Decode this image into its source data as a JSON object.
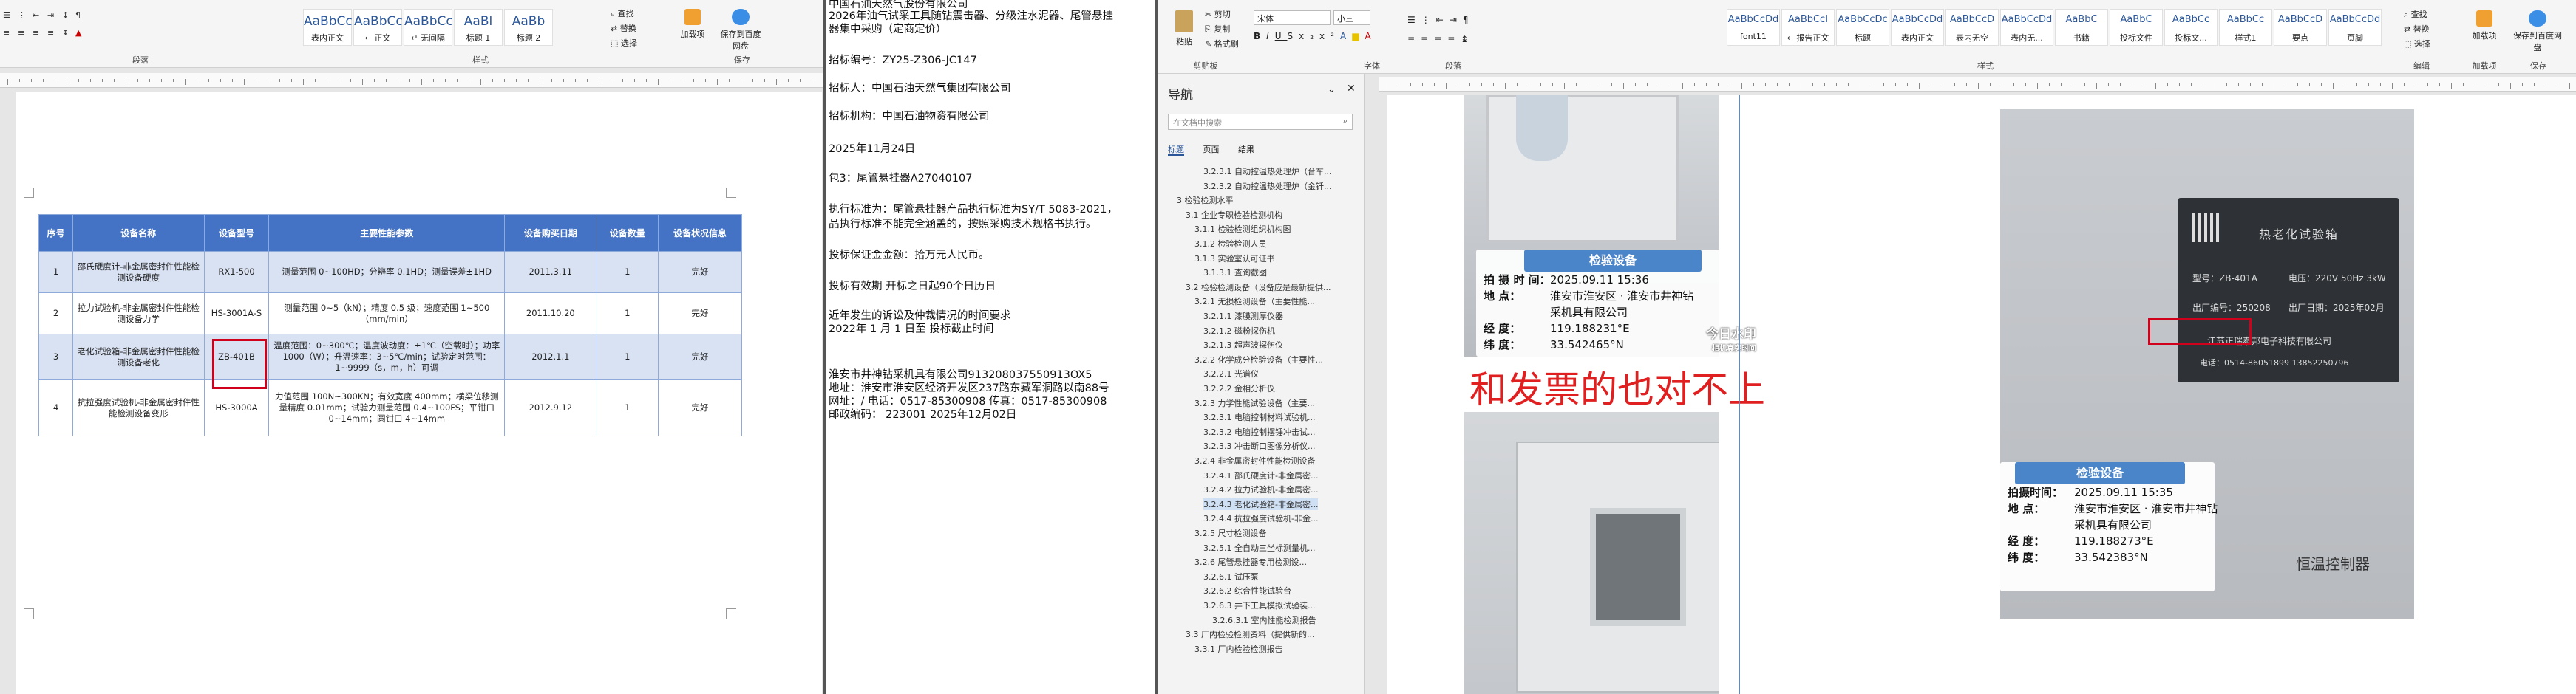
{
  "pane1": {
    "ribbon": {
      "groups": [
        "段落",
        "样式"
      ],
      "styles": [
        {
          "sample": "AaBbCcDd",
          "name": "表内正文"
        },
        {
          "sample": "AaBbCcDd",
          "name": "↵ 正文"
        },
        {
          "sample": "AaBbCcDd",
          "name": "↵ 无间隔"
        },
        {
          "sample": "AaBl",
          "name": "标题 1"
        },
        {
          "sample": "AaBb",
          "name": "标题 2"
        }
      ],
      "edit_items": [
        "查找",
        "替换",
        "选择"
      ],
      "addon_label": "加载项",
      "save_label": "保存到百度网盘",
      "save_group": "保存"
    },
    "table": {
      "headers": [
        "序号",
        "设备名称",
        "设备型号",
        "主要性能参数",
        "设备购买日期",
        "设备数量",
        "设备状况信息"
      ],
      "rows": [
        [
          "1",
          "邵氏硬度计-非金属密封件性能检测设备硬度",
          "RX1-500",
          "测量范围 0~100HD；分辨率 0.1HD；测量误差±1HD",
          "2011.3.11",
          "1",
          "完好"
        ],
        [
          "2",
          "拉力试验机-非金属密封件性能检测设备力学",
          "HS-3001A-S",
          "测量范围 0~5（kN）；精度 0.5 级；速度范围 1~500（mm/min）",
          "2011.10.20",
          "1",
          "完好"
        ],
        [
          "3",
          "老化试验箱-非金属密封件性能检测设备老化",
          "ZB-401B",
          "温度范围：0~300℃；温度波动度：±1℃（空载时）；功率 1000（W）；升温速率：3~5℃/min；试验定时范围： 1~9999（s，m，h）可调",
          "2012.1.1",
          "1",
          "完好"
        ],
        [
          "4",
          "抗拉强度试验机-非金属密封件性能检测设备变形",
          "HS-3000A",
          "力值范围 100N~300KN；有效宽度 400mm；横梁位移测量精度 0.01mm；试验力测量范围 0.4~100FS；平钳口 0~14mm；圆钳口 4~14mm",
          "2012.9.12",
          "1",
          "完好"
        ]
      ]
    }
  },
  "pane2": {
    "lines": [
      "中国石油天然气股份有限公司",
      "2026年油气试采工具随钻震击器、分级注水泥器、尾管悬挂",
      "器集中采购（定商定价）",
      "招标编号：ZY25-Z306-JC147",
      "招标人：中国石油天然气集团有限公司",
      "招标机构：中国石油物资有限公司",
      "2025年11月24日",
      "包3：尾管悬挂器A27040107",
      "执行标准为：尾管悬挂器产品执行标准为SY/T 5083-2021，",
      "品执行标准不能完全涵盖的，按照采购技术规格书执行。",
      "投标保证金金额：拾万元人民币。",
      "投标有效期  开标之日起90个日历日",
      "近年发生的诉讼及仲裁情况的时间要求",
      "2022年 1 月 1 日至 投标截止时间",
      "淮安市井神钻采机具有限公司913208037550913OX5",
      "地址：淮安市淮安区经济开发区237路东藏军洞路以南88号",
      "网址：/  电话：0517-85300908    传真：0517-85300908",
      "邮政编码：    223001                   2025年12月02日"
    ]
  },
  "pane3": {
    "ribbon": {
      "font_name": "宋体",
      "font_size": "小三",
      "groups": [
        "剪贴板",
        "字体",
        "段落",
        "样式",
        "编辑",
        "加载项",
        "保存"
      ],
      "clipboard": [
        "剪切",
        "复制",
        "格式刷"
      ],
      "paste_label": "粘贴",
      "styles": [
        {
          "sample": "AaBbCcDd",
          "name": "font11"
        },
        {
          "sample": "AaBbCcI",
          "name": "↵ 报告正文"
        },
        {
          "sample": "AaBbCcDc",
          "name": "标题"
        },
        {
          "sample": "AaBbCcDd",
          "name": "表内正文"
        },
        {
          "sample": "AaBbCcD",
          "name": "表内无空"
        },
        {
          "sample": "AaBbCcDd",
          "name": "表内无..."
        },
        {
          "sample": "AaBbC",
          "name": "书籍"
        },
        {
          "sample": "AaBbC",
          "name": "投标文件"
        },
        {
          "sample": "AaBbCc",
          "name": "投标文..."
        },
        {
          "sample": "AaBbCc",
          "name": "样式1"
        },
        {
          "sample": "AaBbCcD",
          "name": "要点"
        },
        {
          "sample": "AaBbCcDd",
          "name": "页脚"
        }
      ],
      "edit_items": [
        "查找",
        "替换",
        "选择"
      ],
      "addon_label": "加载项",
      "save_label": "保存到百度网盘"
    },
    "nav": {
      "title": "导航",
      "search_placeholder": "在文档中搜索",
      "tabs": [
        "标题",
        "页面",
        "结果"
      ],
      "items": [
        "3.2.3.1 自动控温热处理炉（台车...",
        "3.2.3.2 自动控温热处理炉（金钎...",
        "3 检验检测水平",
        "3.1 企业专职检验检测机构",
        "3.1.1 检验检测组织机构图",
        "3.1.2 检验检测人员",
        "3.1.3 实验室认可证书",
        "3.1.3.1 查询截图",
        "3.2 检验检测设备（设备应是最新提供...",
        "3.2.1 无损检测设备（主要性能...",
        "3.2.1.1 漆膜测厚仪器",
        "3.2.1.2 磁粉探伤机",
        "3.2.1.3 超声波探伤仪",
        "3.2.2 化学成分检验设备（主要性...",
        "3.2.2.1 光谱仪",
        "3.2.2.2 金相分析仪",
        "3.2.3 力学性能试验设备（主要...",
        "3.2.3.1 电脑控制材料试验机...",
        "3.2.3.2 电脑控制摆锤冲击试...",
        "3.2.3.3 冲击断口图像分析仪...",
        "3.2.4 非金属密封件性能检测设备",
        "3.2.4.1 邵氏硬度计-非金属密...",
        "3.2.4.2 拉力试验机-非金属密...",
        "3.2.4.3 老化试验箱-非金属密...",
        "3.2.4.4 抗拉强度试验机-非金...",
        "3.2.5 尺寸检测设备",
        "3.2.5.1 全自动三坐标测量机...",
        "3.2.6 尾管悬挂器专用检测设...",
        "3.2.6.1 试压泵",
        "3.2.6.2 综合性能试验台",
        "3.2.6.3 井下工具模拟试验装...",
        "3.2.6.3.1 室内性能检测报告",
        "3.3 厂内检验检测资料（提供新的...",
        "3.3.1 厂内检验检测报告"
      ]
    },
    "photo1_stamp": {
      "title": "检验设备",
      "rows": [
        {
          "k": "拍 摄 时 间：",
          "v": "2025.09.11 15:36"
        },
        {
          "k": "地      点：",
          "v": "淮安市淮安区 · 淮安市井神钻"
        },
        {
          "k": "",
          "v": "采机具有限公司"
        },
        {
          "k": "经      度：",
          "v": "119.188231°E"
        },
        {
          "k": "纬      度：",
          "v": "33.542465°N"
        }
      ],
      "watermark": "今日水印",
      "watermark_sub": "相机真实时间"
    },
    "annotation_text": "和发票的也对不上",
    "photo3": {
      "plate_title": "热老化试验箱",
      "plate_model": "型号：ZB-401A",
      "plate_power": "电压：220V 50Hz 3kW",
      "plate_serial": "出厂编号：250208",
      "plate_date": "出厂日期：2025年02月",
      "plate_maker": "江苏正瑞泰邦电子科技有限公司",
      "plate_phone": "电话：0514-86051899 13852250796",
      "stamp_title": "检验设备",
      "stamp_rows": [
        {
          "k": "拍摄时间：",
          "v": "2025.09.11 15:35"
        },
        {
          "k": "地      点：",
          "v": "淮安市淮安区 · 淮安市井神钻"
        },
        {
          "k": "",
          "v": "采机具有限公司"
        },
        {
          "k": "经      度：",
          "v": "119.188273°E"
        },
        {
          "k": "纬      度：",
          "v": "33.542383°N"
        }
      ],
      "controller_label": "恒温控制器"
    },
    "colors": {
      "accent": "#2b579a",
      "highlight": "#d0021b",
      "header": "#4472c4"
    }
  }
}
